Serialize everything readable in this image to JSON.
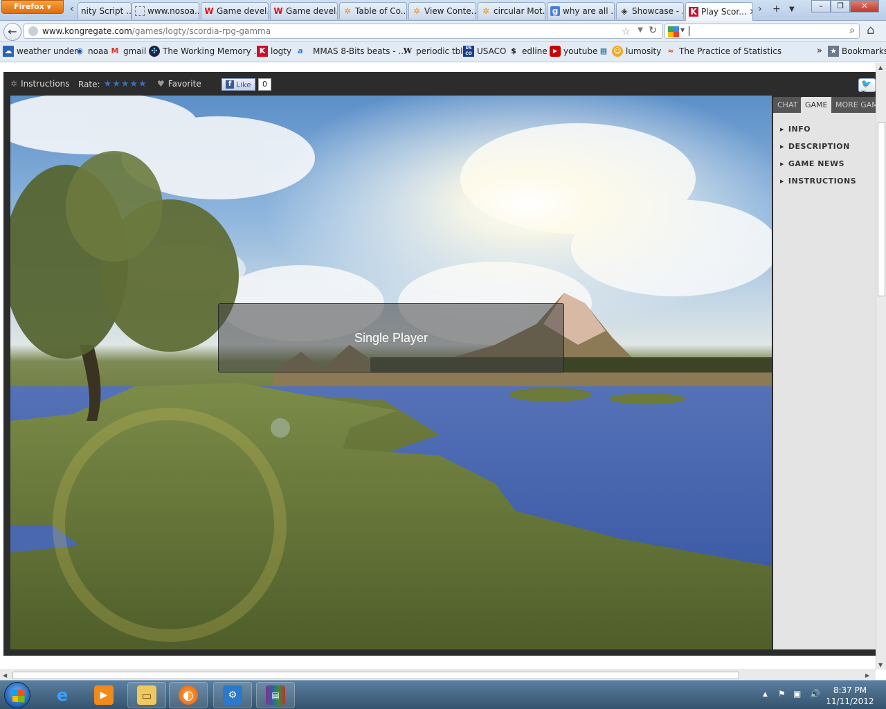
{
  "browser": {
    "menu_button": "Firefox",
    "tabs": [
      {
        "label": "nity Script ...",
        "icon": "unity-icon"
      },
      {
        "label": "www.nosoa...",
        "icon": "page-icon"
      },
      {
        "label": "Game devel...",
        "icon": "wikipedia-icon"
      },
      {
        "label": "Game devel...",
        "icon": "wikipedia-icon"
      },
      {
        "label": "Table of Co...",
        "icon": "dots-icon"
      },
      {
        "label": "View Conte...",
        "icon": "dots-icon"
      },
      {
        "label": "circular Mot...",
        "icon": "dots-icon"
      },
      {
        "label": "why are all ...",
        "icon": "google-icon"
      },
      {
        "label": "Showcase - ...",
        "icon": "unity-icon"
      },
      {
        "label": "Play Scor...",
        "icon": "kongregate-icon"
      }
    ],
    "url_domain": "www.kongregate.com",
    "url_path": "/games/logty/scordia-rpg-gamma",
    "search_value": ""
  },
  "bookmarks": {
    "items": [
      {
        "label": "weather under",
        "icon": "weather-icon"
      },
      {
        "label": "noaa",
        "icon": "noaa-icon"
      },
      {
        "label": "gmail",
        "icon": "gmail-icon"
      },
      {
        "label": "The Working Memory ...",
        "icon": "tree-icon"
      },
      {
        "label": "logty",
        "icon": "kongregate-icon"
      },
      {
        "label": "MMAS 8-Bits beats - ...",
        "icon": "a-icon"
      },
      {
        "label": "periodic tbl",
        "icon": "w-icon"
      },
      {
        "label": "USACO",
        "icon": "usaco-icon"
      },
      {
        "label": "edline",
        "icon": "edline-icon"
      },
      {
        "label": "youtube",
        "icon": "youtube-icon"
      },
      {
        "label": "lumosity",
        "icon": "lumosity-icon"
      },
      {
        "label": "The Practice of Statistics",
        "icon": "stats-icon"
      }
    ],
    "folder_label": "Bookmarks"
  },
  "game_toolbar": {
    "instructions": "Instructions",
    "rate_label": "Rate:",
    "stars": "★★★★★",
    "favorite": "Favorite",
    "like_label": "Like",
    "like_count": "0",
    "tweet_label": "T"
  },
  "game": {
    "menu_button": "Single Player"
  },
  "side_panel": {
    "tabs": [
      "CHAT",
      "GAME",
      "MORE GAM"
    ],
    "items": [
      "INFO",
      "DESCRIPTION",
      "GAME NEWS",
      "INSTRUCTIONS"
    ]
  },
  "taskbar": {
    "time": "8:37 PM",
    "date": "11/11/2012"
  }
}
